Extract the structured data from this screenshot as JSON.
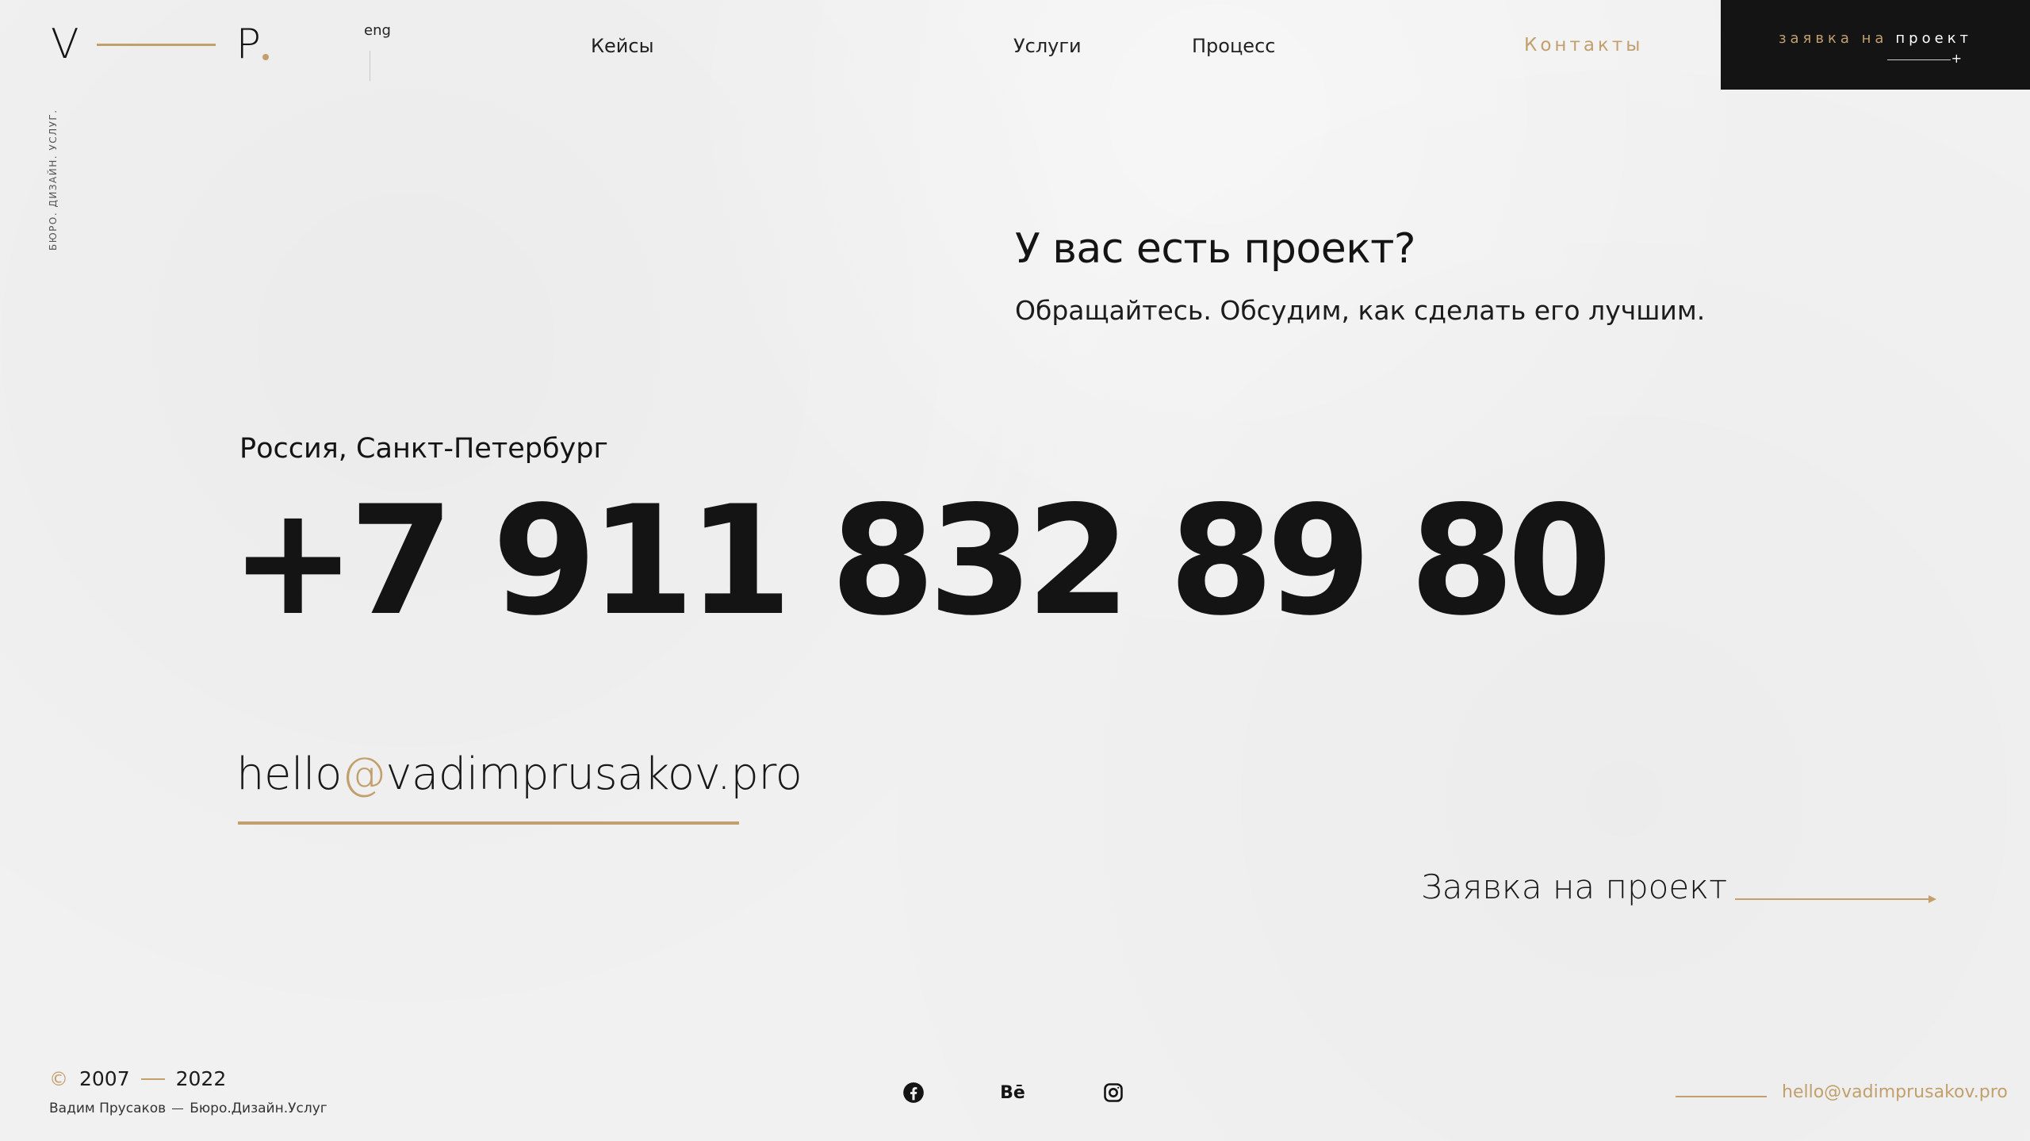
{
  "logo": {
    "left_letter": "V",
    "right_letter": "P"
  },
  "header": {
    "lang": "eng",
    "nav": {
      "cases": "Кейсы",
      "services": "Услуги",
      "process": "Процесс",
      "contacts": "Контакты"
    },
    "cta": {
      "part1": "заявка на",
      "part2": "проект",
      "plus": "+"
    }
  },
  "side_caption": "БЮРО. ДИЗАЙН. УСЛУГ.",
  "hero": {
    "title": "У вас есть проект?",
    "subtitle": "Обращайтесь. Обсудим, как сделать его лучшим."
  },
  "contact": {
    "city": "Россия, Санкт-Петербург",
    "phone": "+7 911 832 89 80",
    "email_user": "hello",
    "email_at": "@",
    "email_domain": "vadimprusakov.pro",
    "request_label": "Заявка на проект"
  },
  "footer": {
    "copyright_symbol": "©",
    "year_from": "2007",
    "year_to": "2022",
    "author": "Вадим Прусаков",
    "studio": "Бюро.Дизайн.Услуг",
    "email": "hello@vadimprusakov.pro",
    "social": {
      "facebook": "facebook-icon",
      "behance_text": "Bē",
      "instagram": "instagram-icon"
    }
  },
  "colors": {
    "accent": "#c2a06d",
    "dark": "#141414",
    "background": "#f1f1f1"
  }
}
